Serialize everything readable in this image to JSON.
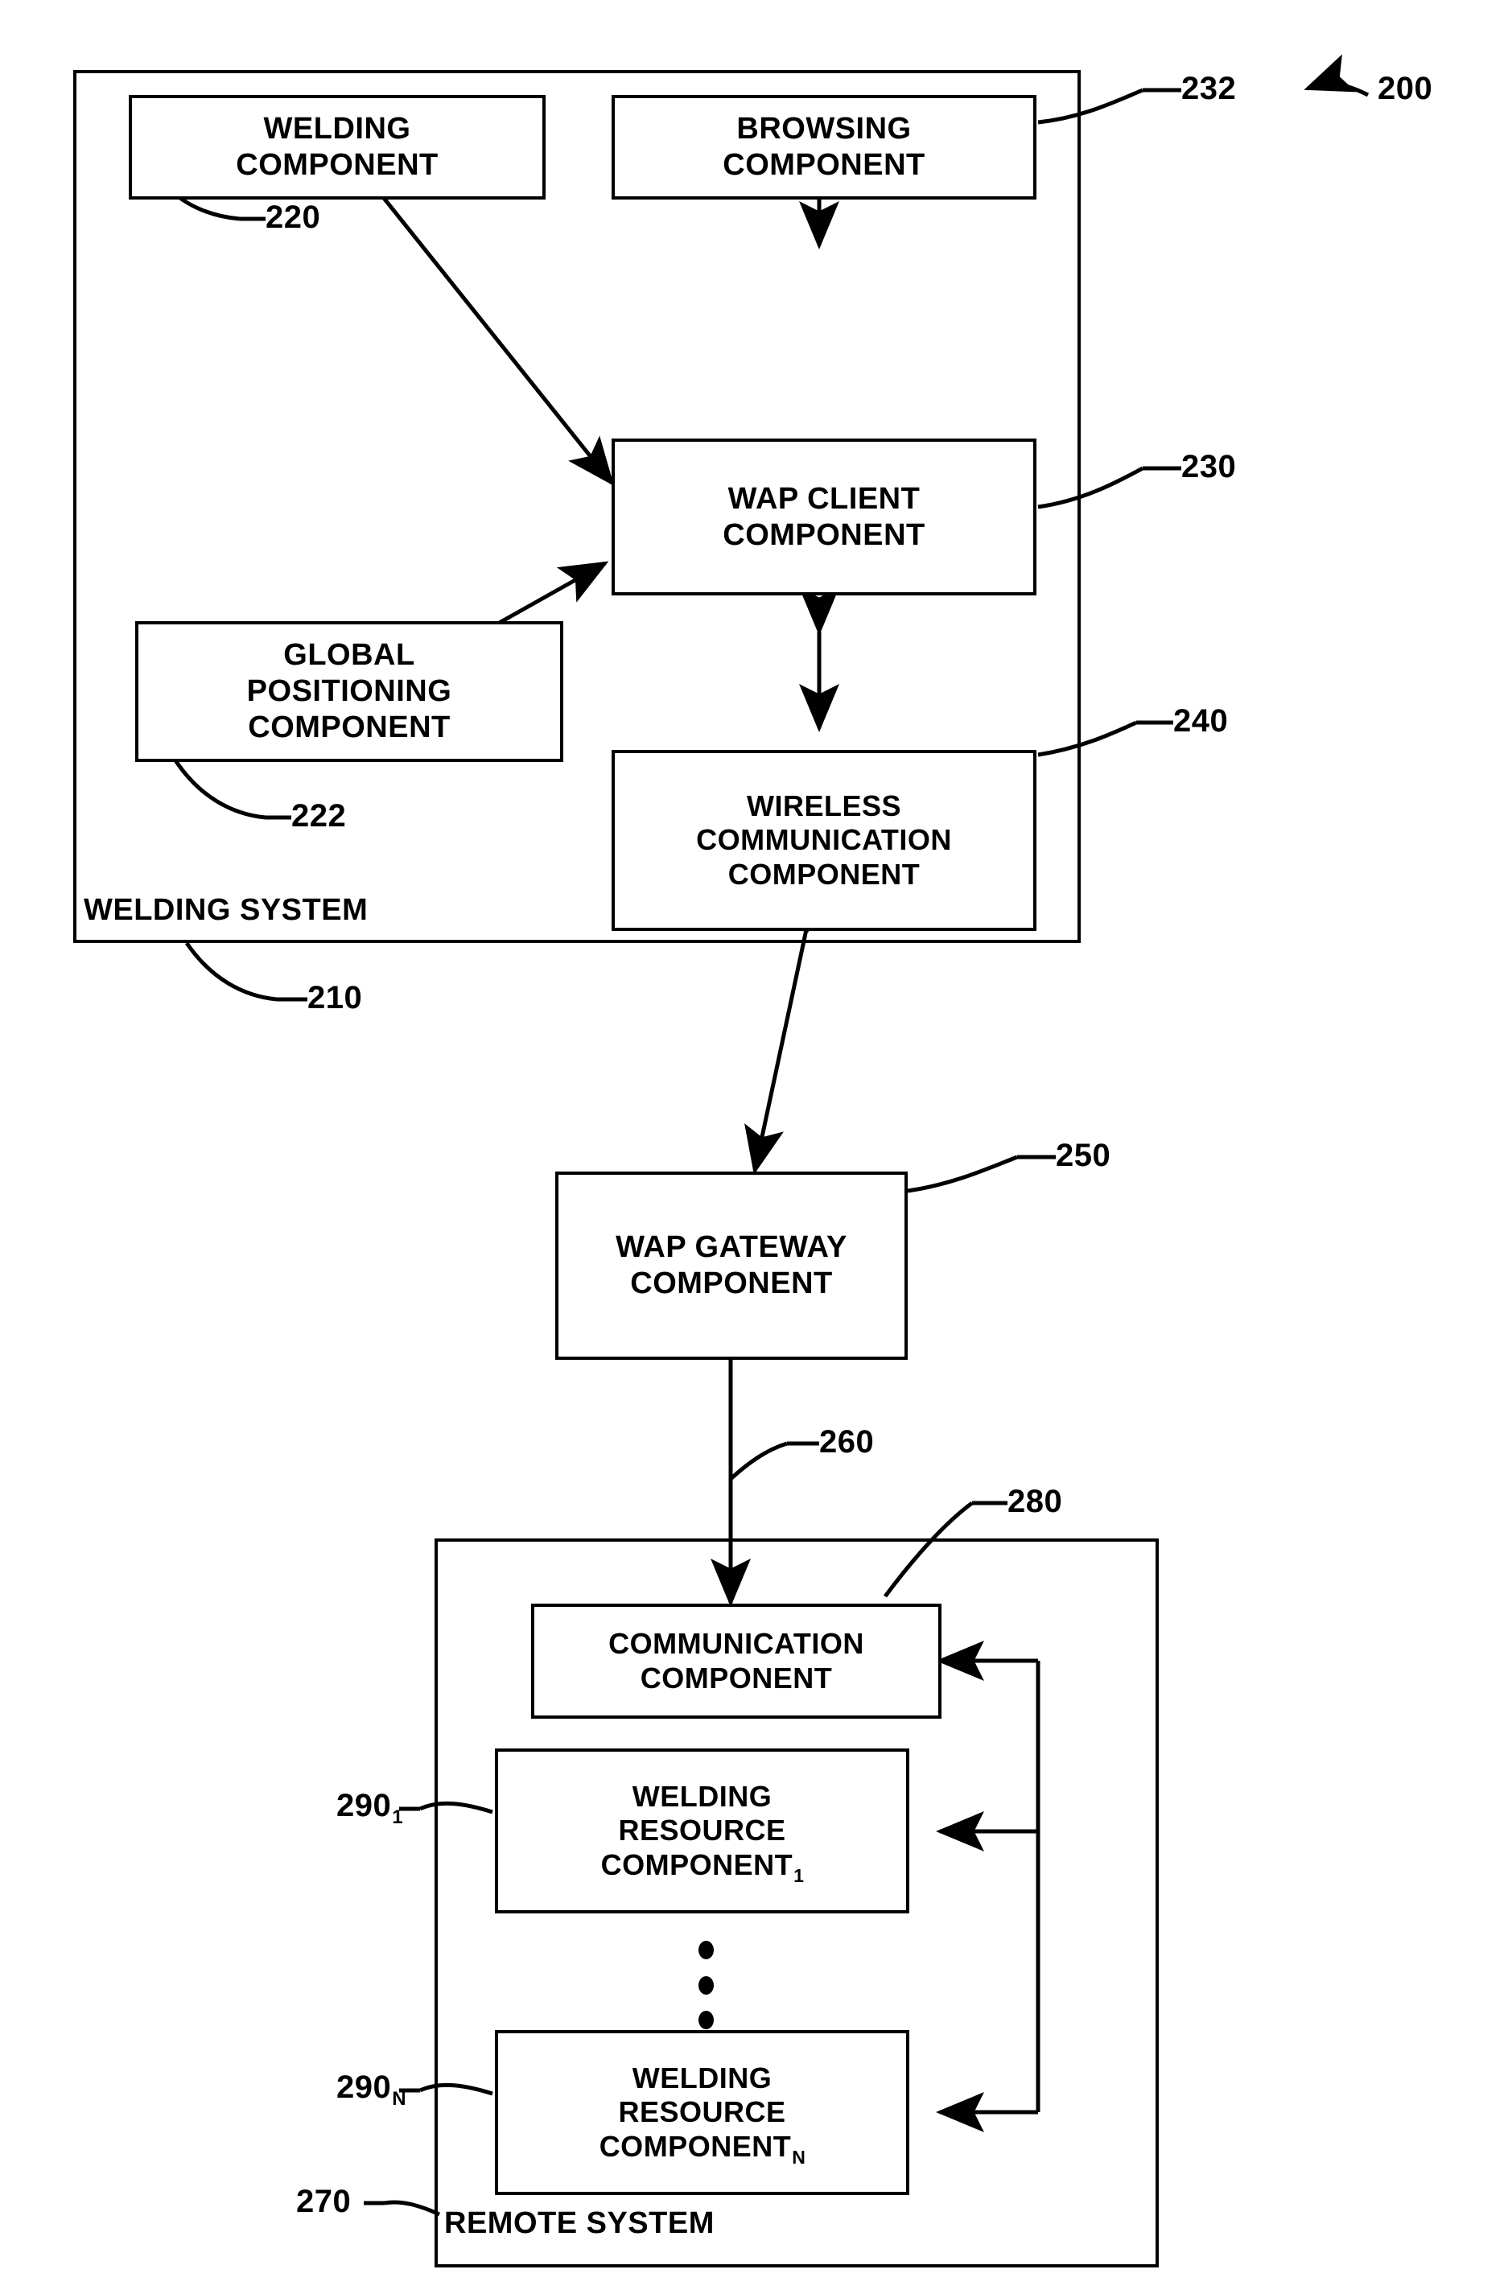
{
  "figure": {
    "number": "200",
    "title_ref": "200"
  },
  "welding_system": {
    "label": "WELDING SYSTEM",
    "ref": "210",
    "components": {
      "welding": {
        "lines": [
          "WELDING",
          "COMPONENT"
        ],
        "ref": "220"
      },
      "browsing": {
        "lines": [
          "BROWSING",
          "COMPONENT"
        ],
        "ref": "232"
      },
      "wap_client": {
        "lines": [
          "WAP CLIENT",
          "COMPONENT"
        ],
        "ref": "230"
      },
      "global_positioning": {
        "lines": [
          "GLOBAL",
          "POSITIONING",
          "COMPONENT"
        ],
        "ref": "222"
      },
      "wireless_communication": {
        "lines": [
          "WIRELESS",
          "COMMUNICATION",
          "COMPONENT"
        ],
        "ref": "240"
      }
    }
  },
  "gateway": {
    "lines": [
      "WAP GATEWAY",
      "COMPONENT"
    ],
    "ref": "250"
  },
  "link": {
    "ref": "260"
  },
  "remote_system": {
    "label": "REMOTE SYSTEM",
    "ref": "270",
    "components": {
      "communication": {
        "lines": [
          "COMMUNICATION",
          "COMPONENT"
        ],
        "ref": "280"
      },
      "welding_resource_1": {
        "line1": "WELDING",
        "line2": "RESOURCE",
        "line3": "COMPONENT",
        "subscript": "1",
        "ref": "290",
        "ref_subscript": "1"
      },
      "welding_resource_n": {
        "line1": "WELDING",
        "line2": "RESOURCE",
        "line3": "COMPONENT",
        "subscript": "N",
        "ref": "290",
        "ref_subscript": "N"
      }
    },
    "ellipsis": "vertical-dots"
  },
  "colors": {
    "stroke": "#000000",
    "background": "#ffffff"
  }
}
